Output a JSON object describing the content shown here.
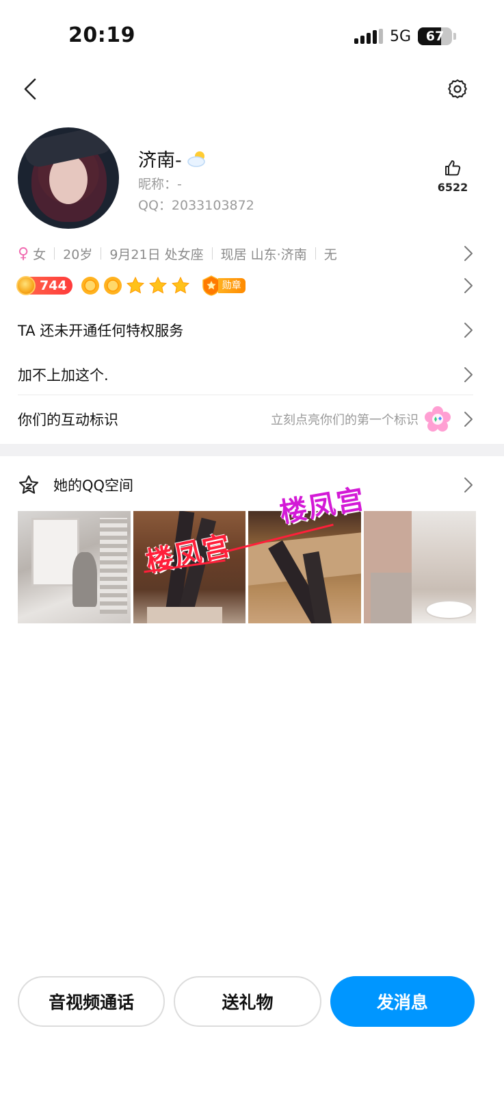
{
  "status_bar": {
    "time": "20:19",
    "network": "5G",
    "battery": "67",
    "battery_level": 0.67
  },
  "profile": {
    "name": "济南-",
    "name_icon": "partly-cloudy-icon",
    "nickname": "昵称：-",
    "qq": "QQ：2033103872",
    "likes": "6522"
  },
  "info": {
    "gender": "女",
    "age": "20岁",
    "birthday": "9月21日 处女座",
    "location": "现居 山东·济南",
    "extra": "无"
  },
  "level": {
    "coin_value": "744",
    "icons": [
      "sun-icon",
      "sun-icon",
      "star-icon",
      "star-icon",
      "star-icon"
    ],
    "medal_label": "勋章"
  },
  "rows": {
    "privilege": "TA 还未开通任何特权服务",
    "signature": "加不上加这个.",
    "interaction_label": "你们的互动标识",
    "interaction_hint": "立刻点亮你们的第一个标识"
  },
  "qzone": {
    "label": "她的QQ空间"
  },
  "photos": {
    "watermark_a": "楼凤宫",
    "watermark_b": "楼凤宫"
  },
  "actions": {
    "call": "音视频通话",
    "gift": "送礼物",
    "message": "发消息"
  },
  "colors": {
    "primary": "#0096ff",
    "female": "#f06ab0",
    "coin_badge": "#ff4a3b"
  }
}
